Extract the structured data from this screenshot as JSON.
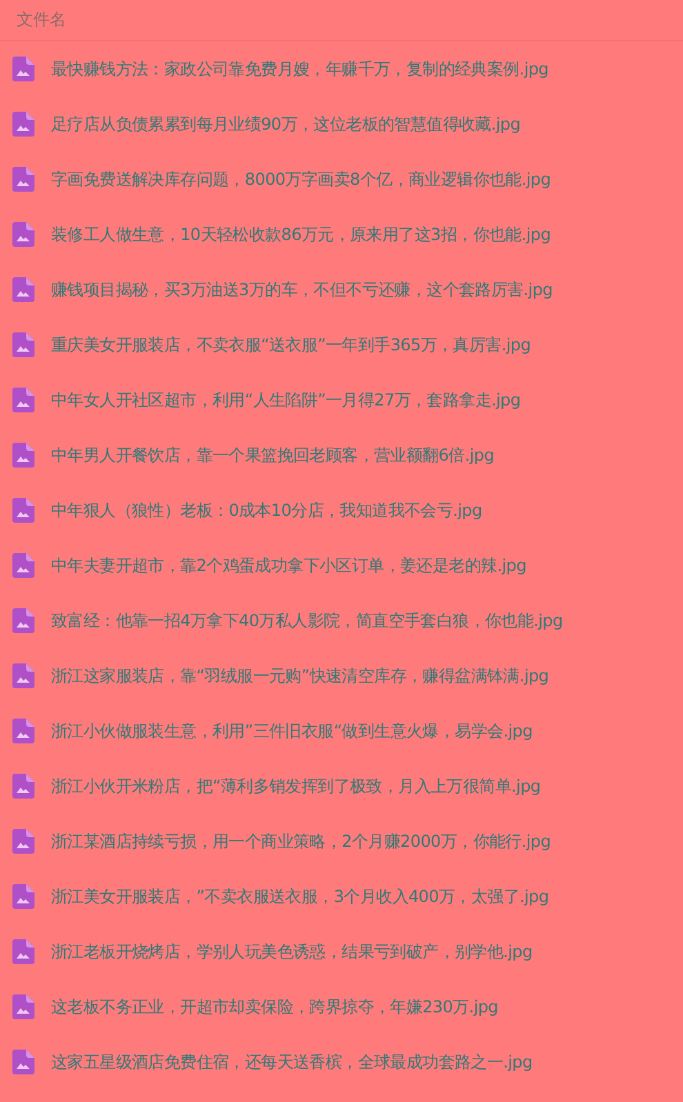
{
  "header": {
    "column": "文件名"
  },
  "files": [
    {
      "name": "最快赚钱方法：家政公司靠免费月嫂，年赚千万，复制的经典案例.jpg"
    },
    {
      "name": "足疗店从负债累累到每月业绩90万，这位老板的智慧值得收藏.jpg"
    },
    {
      "name": "字画免费送解决库存问题，8000万字画卖8个亿，商业逻辑你也能.jpg"
    },
    {
      "name": "装修工人做生意，10天轻松收款86万元，原来用了这3招，你也能.jpg"
    },
    {
      "name": "赚钱项目揭秘，买3万油送3万的车，不但不亏还赚，这个套路厉害.jpg"
    },
    {
      "name": "重庆美女开服装店，不卖衣服“送衣服”一年到手365万，真厉害.jpg"
    },
    {
      "name": "中年女人开社区超市，利用“人生陷阱”一月得27万，套路拿走.jpg"
    },
    {
      "name": "中年男人开餐饮店，靠一个果篮挽回老顾客，营业额翻6倍.jpg"
    },
    {
      "name": "中年狠人（狼性）老板：0成本10分店，我知道我不会亏.jpg"
    },
    {
      "name": "中年夫妻开超市，靠2个鸡蛋成功拿下小区订单，姜还是老的辣.jpg"
    },
    {
      "name": "致富经：他靠一招4万拿下40万私人影院，简直空手套白狼，你也能.jpg"
    },
    {
      "name": "浙江这家服装店，靠“羽绒服一元购”快速清空库存，赚得盆满钵满.jpg"
    },
    {
      "name": "浙江小伙做服装生意，利用”三件旧衣服“做到生意火爆，易学会.jpg"
    },
    {
      "name": "浙江小伙开米粉店，把“薄利多销发挥到了极致，月入上万很简单.jpg"
    },
    {
      "name": "浙江某酒店持续亏损，用一个商业策略，2个月赚2000万，你能行.jpg"
    },
    {
      "name": "浙江美女开服装店，”不卖衣服送衣服，3个月收入400万，太强了.jpg"
    },
    {
      "name": "浙江老板开烧烤店，学别人玩美色诱惑，结果亏到破产，别学他.jpg"
    },
    {
      "name": "这老板不务正业，开超市却卖保险，跨界掠夺，年嫌230万.jpg"
    },
    {
      "name": "这家五星级酒店免费住宿，还每天送香槟，全球最成功套路之一.jpg"
    }
  ]
}
